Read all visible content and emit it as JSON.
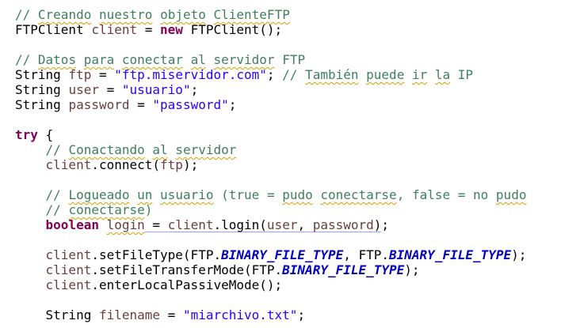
{
  "editor": {
    "language": "Java",
    "lines": [
      {
        "indent": "",
        "tokens": [
          {
            "t": "// ",
            "k": "c"
          },
          {
            "t": "Creando",
            "k": "c",
            "sp": 1
          },
          {
            "t": " ",
            "k": "c"
          },
          {
            "t": "nuestro",
            "k": "c",
            "sp": 1
          },
          {
            "t": " ",
            "k": "c"
          },
          {
            "t": "objeto",
            "k": "c",
            "sp": 1
          },
          {
            "t": " ",
            "k": "c"
          },
          {
            "t": "ClienteFTP",
            "k": "c",
            "sp": 1
          }
        ]
      },
      {
        "indent": "",
        "tokens": [
          {
            "t": "FTPClient ",
            "k": "p"
          },
          {
            "t": "client",
            "k": "v"
          },
          {
            "t": " = ",
            "k": "p"
          },
          {
            "t": "new",
            "k": "k"
          },
          {
            "t": " FTPClient();",
            "k": "p"
          }
        ]
      },
      {
        "indent": "",
        "tokens": []
      },
      {
        "indent": "",
        "tokens": [
          {
            "t": "// ",
            "k": "c"
          },
          {
            "t": "Datos",
            "k": "c",
            "sp": 1
          },
          {
            "t": " ",
            "k": "c"
          },
          {
            "t": "para",
            "k": "c",
            "sp": 1
          },
          {
            "t": " ",
            "k": "c"
          },
          {
            "t": "conectar",
            "k": "c",
            "sp": 1
          },
          {
            "t": " ",
            "k": "c"
          },
          {
            "t": "al",
            "k": "c",
            "sp": 1
          },
          {
            "t": " ",
            "k": "c"
          },
          {
            "t": "servidor",
            "k": "c",
            "sp": 1
          },
          {
            "t": " FTP",
            "k": "c"
          }
        ]
      },
      {
        "indent": "",
        "tokens": [
          {
            "t": "String ",
            "k": "p"
          },
          {
            "t": "ftp",
            "k": "v"
          },
          {
            "t": " = ",
            "k": "p"
          },
          {
            "t": "\"ftp.miservidor.com\"",
            "k": "s"
          },
          {
            "t": "; ",
            "k": "p"
          },
          {
            "t": "// ",
            "k": "c"
          },
          {
            "t": "También",
            "k": "c",
            "sp": 1
          },
          {
            "t": " ",
            "k": "c"
          },
          {
            "t": "puede",
            "k": "c",
            "sp": 1
          },
          {
            "t": " ",
            "k": "c"
          },
          {
            "t": "ir",
            "k": "c",
            "sp": 1
          },
          {
            "t": " ",
            "k": "c"
          },
          {
            "t": "la",
            "k": "c",
            "sp": 1
          },
          {
            "t": " IP",
            "k": "c"
          }
        ]
      },
      {
        "indent": "",
        "tokens": [
          {
            "t": "String ",
            "k": "p"
          },
          {
            "t": "user",
            "k": "v"
          },
          {
            "t": " = ",
            "k": "p"
          },
          {
            "t": "\"usuario\"",
            "k": "s"
          },
          {
            "t": ";",
            "k": "p"
          }
        ]
      },
      {
        "indent": "",
        "tokens": [
          {
            "t": "String ",
            "k": "p"
          },
          {
            "t": "password",
            "k": "v"
          },
          {
            "t": " = ",
            "k": "p"
          },
          {
            "t": "\"password\"",
            "k": "s"
          },
          {
            "t": ";",
            "k": "p"
          }
        ]
      },
      {
        "indent": "",
        "tokens": []
      },
      {
        "indent": "",
        "tokens": [
          {
            "t": "try",
            "k": "k"
          },
          {
            "t": " {",
            "k": "p"
          }
        ]
      },
      {
        "indent": "    ",
        "tokens": [
          {
            "t": "// ",
            "k": "c"
          },
          {
            "t": "Conactando",
            "k": "c",
            "sp": 1
          },
          {
            "t": " ",
            "k": "c"
          },
          {
            "t": "al",
            "k": "c",
            "sp": 1
          },
          {
            "t": " ",
            "k": "c"
          },
          {
            "t": "servidor",
            "k": "c",
            "sp": 1
          }
        ]
      },
      {
        "indent": "    ",
        "tokens": [
          {
            "t": "client",
            "k": "v"
          },
          {
            "t": ".connect(",
            "k": "p"
          },
          {
            "t": "ftp",
            "k": "v"
          },
          {
            "t": ");",
            "k": "p"
          }
        ]
      },
      {
        "indent": "",
        "tokens": []
      },
      {
        "indent": "    ",
        "tokens": [
          {
            "t": "// ",
            "k": "c"
          },
          {
            "t": "Logueado",
            "k": "c",
            "sp": 1
          },
          {
            "t": " ",
            "k": "c"
          },
          {
            "t": "un",
            "k": "c",
            "sp": 1
          },
          {
            "t": " ",
            "k": "c"
          },
          {
            "t": "usuario",
            "k": "c",
            "sp": 1
          },
          {
            "t": " (true = ",
            "k": "c"
          },
          {
            "t": "pudo",
            "k": "c",
            "sp": 1
          },
          {
            "t": " ",
            "k": "c"
          },
          {
            "t": "conectarse",
            "k": "c",
            "sp": 1
          },
          {
            "t": ", false = no ",
            "k": "c"
          },
          {
            "t": "pudo",
            "k": "c",
            "sp": 1
          }
        ]
      },
      {
        "indent": "    ",
        "tokens": [
          {
            "t": "// ",
            "k": "c"
          },
          {
            "t": "conectarse",
            "k": "c",
            "sp": 1
          },
          {
            "t": ")",
            "k": "c"
          }
        ]
      },
      {
        "indent": "    ",
        "tokens": [
          {
            "t": "boolean",
            "k": "k"
          },
          {
            "t": " ",
            "k": "p"
          },
          {
            "t": "login",
            "k": "v",
            "sp": 1
          },
          {
            "t": " = ",
            "k": "p",
            "occ": 1
          },
          {
            "t": "client",
            "k": "v",
            "occ": 1
          },
          {
            "t": ".login(",
            "k": "p",
            "occ": 1
          },
          {
            "t": "user",
            "k": "v",
            "occ": 1
          },
          {
            "t": ", ",
            "k": "p",
            "occ": 1
          },
          {
            "t": "password",
            "k": "v",
            "occ": 1
          },
          {
            "t": ")",
            "k": "p",
            "occ": 1
          },
          {
            "t": ";",
            "k": "p"
          }
        ]
      },
      {
        "indent": "",
        "tokens": []
      },
      {
        "indent": "    ",
        "tokens": [
          {
            "t": "client",
            "k": "v"
          },
          {
            "t": ".setFileType(FTP.",
            "k": "p"
          },
          {
            "t": "BINARY_FILE_TYPE",
            "k": "sf"
          },
          {
            "t": ", FTP.",
            "k": "p"
          },
          {
            "t": "BINARY_FILE_TYPE",
            "k": "sf"
          },
          {
            "t": ");",
            "k": "p"
          }
        ]
      },
      {
        "indent": "    ",
        "tokens": [
          {
            "t": "client",
            "k": "v"
          },
          {
            "t": ".setFileTransferMode(FTP.",
            "k": "p"
          },
          {
            "t": "BINARY_FILE_TYPE",
            "k": "sf"
          },
          {
            "t": ");",
            "k": "p"
          }
        ]
      },
      {
        "indent": "    ",
        "tokens": [
          {
            "t": "client",
            "k": "v"
          },
          {
            "t": ".enterLocalPassiveMode();",
            "k": "p"
          }
        ]
      },
      {
        "indent": "",
        "tokens": []
      },
      {
        "indent": "    ",
        "tokens": [
          {
            "t": "String ",
            "k": "p"
          },
          {
            "t": "filename",
            "k": "v"
          },
          {
            "t": " = ",
            "k": "p"
          },
          {
            "t": "\"miarchivo.txt\"",
            "k": "s"
          },
          {
            "t": ";",
            "k": "p"
          }
        ]
      }
    ]
  }
}
